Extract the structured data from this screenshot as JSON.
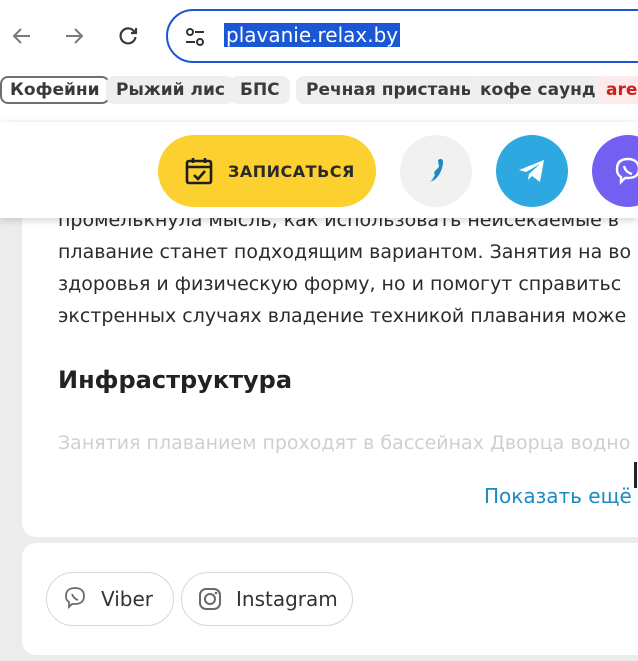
{
  "browser": {
    "url": "plavanie.relax.by",
    "bookmarks": [
      {
        "label": "Кофейни",
        "active": true
      },
      {
        "label": "Рыжий лис"
      },
      {
        "label": "БПС"
      },
      {
        "label": "Речная пристань"
      },
      {
        "label": "кофе саунд"
      },
      {
        "label": "arer"
      }
    ]
  },
  "sticky": {
    "signup_label": "ЗАПИСАТЬСЯ"
  },
  "content": {
    "lines": [
      "промелькнула мысль, как использовать неисекаемые в",
      "плавание станет подходящим вариантом. Занятия на во",
      "здоровья и физическую форму, но и помогут справитьс",
      "экстренных случаях владение техникой плавания може"
    ],
    "heading": "Инфраструктура",
    "faded_text": "Занятия плаванием проходят в бассейнах Дворца водно",
    "show_more": "Показать ещё"
  },
  "socials": {
    "viber": "Viber",
    "instagram": "Instagram"
  },
  "colors": {
    "accent_yellow": "#fcd02e",
    "phone_bg": "#f1f1f1",
    "telegram": "#2ea8e0",
    "viber": "#7360f2",
    "link": "#1b89c2"
  }
}
